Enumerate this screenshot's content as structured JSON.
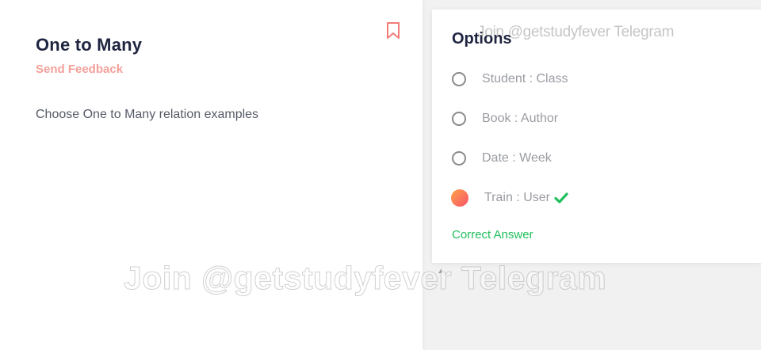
{
  "question": {
    "title": "One to Many",
    "feedback_label": "Send Feedback",
    "text": "Choose One to Many relation examples",
    "bookmark_icon": "bookmark-icon"
  },
  "options": {
    "title": "Options",
    "items": [
      {
        "label": "Student : Class",
        "selected": false
      },
      {
        "label": "Book : Author",
        "selected": false
      },
      {
        "label": "Date : Week",
        "selected": false
      },
      {
        "label": "Train : User",
        "selected": true,
        "correct": true
      }
    ],
    "correct_label": "Correct Answer"
  },
  "watermark": {
    "top": "Join @getstudyfever Telegram",
    "center": "Join @getstudyfever Telegram"
  },
  "colors": {
    "accent_feedback": "#f4a09a",
    "correct_green": "#1fbf5c",
    "title_dark": "#1f2540",
    "selected_gradient_start": "#ffa24a",
    "selected_gradient_end": "#f6546a"
  }
}
